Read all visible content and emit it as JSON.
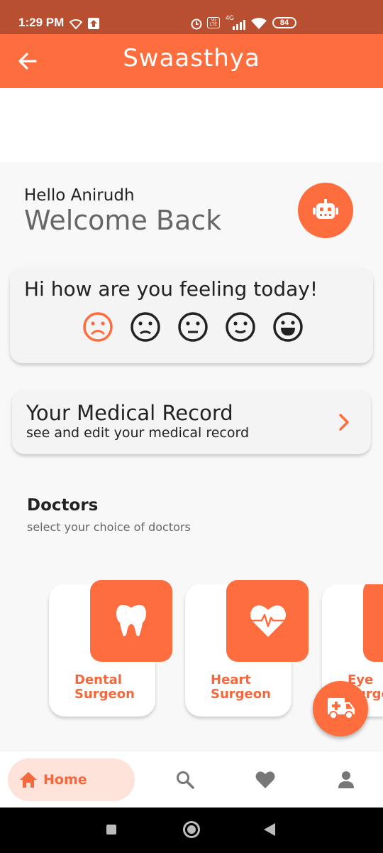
{
  "status_bar": {
    "time": "1:29 PM",
    "battery": "84",
    "network_label": "4G",
    "volte_label": "Vo LTE"
  },
  "app_bar": {
    "title": "Swaasthya"
  },
  "greeting": {
    "hello": "Hello Anirudh",
    "welcome": "Welcome Back"
  },
  "mood": {
    "question": "Hi how are you feeling today!",
    "faces": [
      "sad",
      "frown",
      "neutral",
      "slight-smile",
      "happy"
    ],
    "selected": "sad"
  },
  "medical_record": {
    "title": "Your Medical Record",
    "subtitle": "see and edit your medical record"
  },
  "doctors": {
    "title": "Doctors",
    "subtitle": "select your choice of doctors",
    "items": [
      {
        "label_line1": "Dental",
        "label_line2": "Surgeon",
        "icon": "tooth-icon"
      },
      {
        "label_line1": "Heart",
        "label_line2": "Surgeon",
        "icon": "heart-pulse-icon"
      },
      {
        "label_line1": "Eye",
        "label_line2": "Surgeon",
        "icon": "eye-icon"
      }
    ]
  },
  "bottom_nav": {
    "home_label": "Home",
    "items": [
      "home",
      "search",
      "favorites",
      "profile"
    ],
    "active": "home"
  },
  "colors": {
    "accent": "#fe6d3e",
    "status_bar": "#b84f31",
    "home_pill": "#fde3da",
    "label_accent": "#f3683d"
  }
}
